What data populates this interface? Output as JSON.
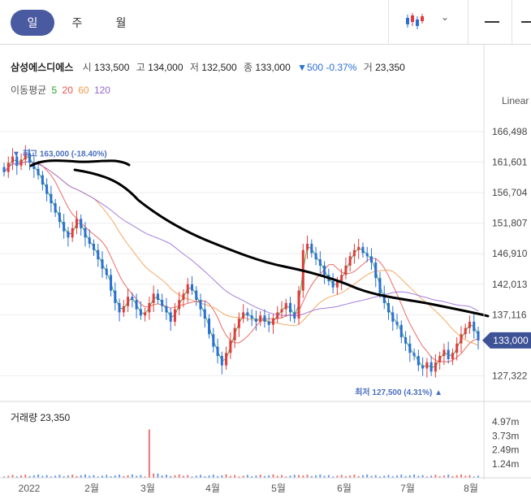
{
  "tabs": [
    {
      "label": "일",
      "active": true
    },
    {
      "label": "주",
      "active": false
    },
    {
      "label": "월",
      "active": false
    }
  ],
  "icons": {
    "chart_type": "candlestick-icon",
    "dropdown": "chevron-down-icon"
  },
  "stock": {
    "name": "삼성에스디에스",
    "open_label": "시",
    "open": "133,500",
    "high_label": "고",
    "high": "134,000",
    "low_label": "저",
    "low": "132,500",
    "close_label": "종",
    "close": "133,000",
    "change": "▼500 -0.37%",
    "volume_label": "거",
    "volume": "23,350"
  },
  "moving_average": {
    "label": "이동평균",
    "periods": [
      {
        "value": "5",
        "color": "#2ca02c"
      },
      {
        "value": "20",
        "color": "#e8524d"
      },
      {
        "value": "60",
        "color": "#f29b4b"
      },
      {
        "value": "120",
        "color": "#9467d6"
      }
    ]
  },
  "scale_label": "Linear",
  "volume_header": "거래량 23,350",
  "colors": {
    "up": "#e23b3b",
    "down": "#2a6fd6",
    "accent": "#4a5aa0"
  },
  "chart_data": {
    "type": "candlestick",
    "y_ticks": [
      "166,498",
      "161,601",
      "156,704",
      "151,807",
      "146,910",
      "142,013",
      "137,116",
      "127,322"
    ],
    "ylim": [
      124000,
      170000
    ],
    "x_ticks": [
      "2022",
      "2월",
      "3월",
      "4월",
      "5월",
      "6월",
      "7월",
      "8월"
    ],
    "current_price_tag": "133,000",
    "current_price": 133000,
    "high_annotation": "▼ 최고 163,000 (-18.40%)",
    "high_value": 163000,
    "low_annotation": "최저 127,500 (4.31%) ▲",
    "low_value": 127500,
    "volume_ticks": [
      "4.97m",
      "3.73m",
      "2.49m",
      "1.24m"
    ],
    "volume_ylim": [
      0,
      6000000
    ],
    "closes": [
      160000,
      161500,
      162500,
      161000,
      162000,
      163000,
      161500,
      160500,
      159500,
      158000,
      156500,
      155000,
      153500,
      152000,
      150500,
      149500,
      151000,
      152500,
      151000,
      149500,
      148500,
      147500,
      146000,
      144500,
      143500,
      141000,
      139000,
      137500,
      138500,
      140000,
      139500,
      138000,
      137000,
      137500,
      139000,
      140500,
      139500,
      138500,
      137500,
      136000,
      138000,
      139500,
      140500,
      142000,
      141000,
      139500,
      138000,
      136500,
      134000,
      132000,
      130500,
      129000,
      131000,
      133000,
      135000,
      136500,
      137500,
      137000,
      136500,
      136000,
      137000,
      136000,
      135500,
      136500,
      137500,
      138000,
      139000,
      137500,
      136500,
      141000,
      147500,
      148500,
      147000,
      146000,
      145000,
      143500,
      142500,
      141500,
      142500,
      143500,
      145000,
      146500,
      147500,
      148000,
      147000,
      146500,
      145500,
      143000,
      140500,
      139000,
      137500,
      136000,
      135500,
      133500,
      132500,
      131000,
      130500,
      129000,
      128500,
      129500,
      128000,
      129500,
      130500,
      131500,
      130000,
      131000,
      132500,
      134000,
      135000,
      136000,
      134500,
      133000
    ],
    "ma_count": 4
  }
}
